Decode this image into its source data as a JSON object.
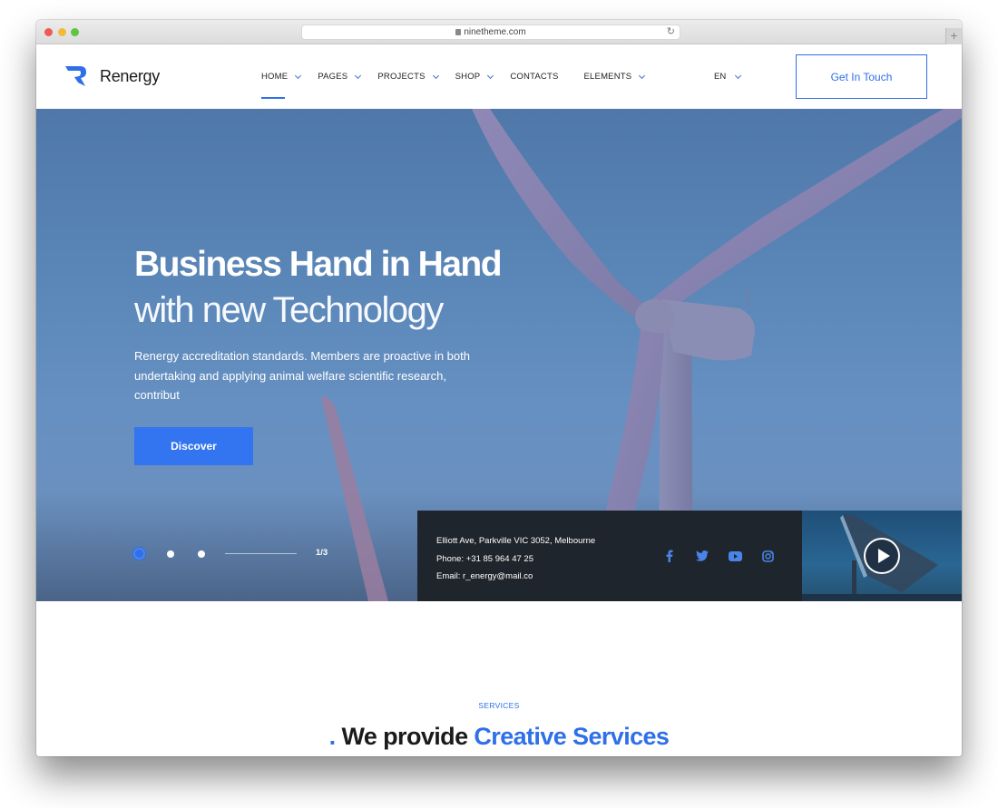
{
  "browser": {
    "url": "ninetheme.com",
    "new_tab_label": "+"
  },
  "header": {
    "brand": "Renergy",
    "nav": [
      {
        "label": "HOME",
        "dropdown": true,
        "active": true
      },
      {
        "label": "PAGES",
        "dropdown": true
      },
      {
        "label": "PROJECTS",
        "dropdown": true
      },
      {
        "label": "SHOP",
        "dropdown": true
      },
      {
        "label": "CONTACTS",
        "dropdown": false
      },
      {
        "label": "ELEMENTS",
        "dropdown": true
      }
    ],
    "language": "EN",
    "cta_label": "Get In Touch"
  },
  "hero": {
    "title": "Business Hand in Hand",
    "subtitle": "with new Technology",
    "description": "Renergy accreditation standards. Members are proactive in both undertaking and applying animal welfare scientific research, contribut",
    "button_label": "Discover",
    "slider": {
      "current": 1,
      "total": 3,
      "counter_text": "1/3"
    }
  },
  "contact": {
    "address": "Elliott Ave, Parkville VIC 3052, Melbourne",
    "phone": "Phone: +31 85 964 47 25",
    "email": "Email: r_energy@mail.co",
    "social": [
      "facebook-icon",
      "twitter-icon",
      "youtube-icon",
      "instagram-icon"
    ]
  },
  "services": {
    "eyebrow": "SERVICES",
    "title_prefix": ".",
    "title_plain": " We provide ",
    "title_highlight": "Creative Services"
  },
  "colors": {
    "accent": "#2f6fe8",
    "dark_panel": "#1f252c",
    "hero_blue": "#5a86b8"
  }
}
